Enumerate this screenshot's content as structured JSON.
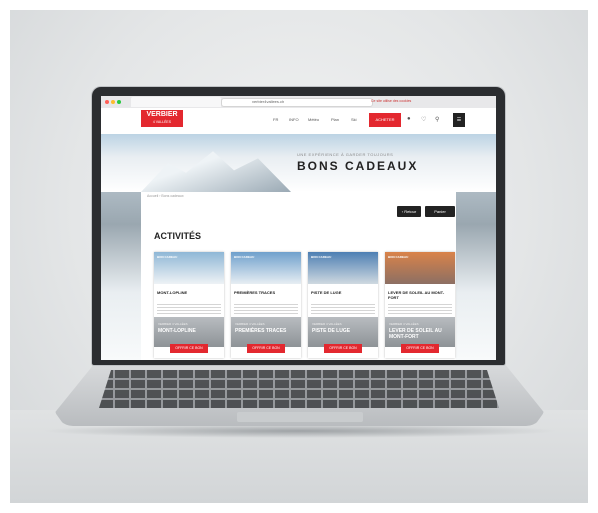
{
  "browser": {
    "url": "verbier4vallees.ch",
    "notice": "Ce site utilise des cookies"
  },
  "header": {
    "logo_main": "VERBIER",
    "logo_sub": "4 VALLÉES",
    "nav": [
      "FR",
      "INFO",
      "Météo",
      "Plan",
      "Ski"
    ],
    "cta_label": "ACHETER",
    "icons": [
      "user-icon",
      "heart-icon",
      "search-icon",
      "menu-icon"
    ]
  },
  "hero": {
    "subtitle": "UNE EXPÉRIENCE À GARDER TOUJOURS",
    "title": "BONS CADEAUX"
  },
  "breadcrumb": "Accueil › Bons cadeaux",
  "actions": {
    "back_label": "‹ Retour",
    "cart_label": "Panier"
  },
  "section_title": "ACTIVITÉS",
  "cards": [
    {
      "tag": "BON CADEAU",
      "name": "MONT-LOPLINE",
      "foot_sub": "VERBIER 4 VALLÉES",
      "foot_title": "MONT-LOPLINE",
      "button": "OFFRIR CE BON",
      "img_top": "#8fb7d6",
      "img_bottom": "#eef2f5"
    },
    {
      "tag": "BON CADEAU",
      "name": "PREMIÈRES TRACES",
      "foot_sub": "VERBIER 4 VALLÉES",
      "foot_title": "PREMIÈRES TRACES",
      "button": "OFFRIR CE BON",
      "img_top": "#6fa0cc",
      "img_bottom": "#e7eef3"
    },
    {
      "tag": "BON CADEAU",
      "name": "PISTE DE LUGE",
      "foot_sub": "VERBIER 4 VALLÉES",
      "foot_title": "PISTE DE LUGE",
      "button": "OFFRIR CE BON",
      "img_top": "#4d7fb3",
      "img_bottom": "#cfd9e0"
    },
    {
      "tag": "BON CADEAU",
      "name": "LEVER DE SOLEIL AU MONT-FORT",
      "foot_sub": "VERBIER 4 VALLÉES",
      "foot_title": "LEVER DE SOLEIL AU MONT-FORT",
      "button": "OFFRIR CE BON",
      "img_top": "#d9834a",
      "img_bottom": "#8c6f63"
    }
  ],
  "colors": {
    "brand_red": "#e3282f",
    "dark": "#222222"
  }
}
